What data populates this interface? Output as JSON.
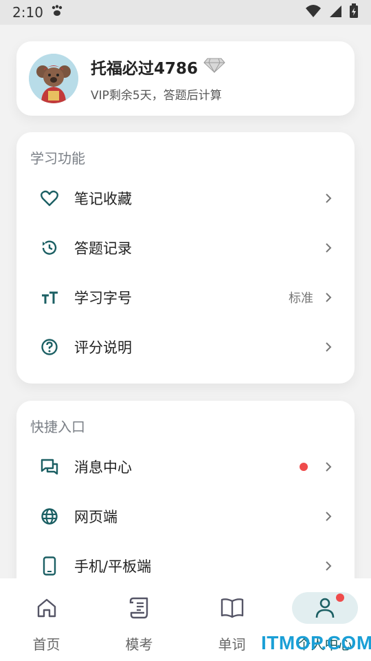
{
  "status_bar": {
    "time": "2:10"
  },
  "profile": {
    "name": "托福必过4786",
    "subtitle": "VIP剩余5天，答题后计算"
  },
  "learning": {
    "title": "学习功能",
    "items": [
      {
        "label": "笔记收藏",
        "icon": "heart-icon"
      },
      {
        "label": "答题记录",
        "icon": "history-icon"
      },
      {
        "label": "学习字号",
        "icon": "text-size-icon",
        "value": "标准"
      },
      {
        "label": "评分说明",
        "icon": "help-circle-icon"
      }
    ]
  },
  "quick": {
    "title": "快捷入口",
    "items": [
      {
        "label": "消息中心",
        "icon": "message-icon",
        "dot": true
      },
      {
        "label": "网页端",
        "icon": "globe-icon"
      },
      {
        "label": "手机/平板端",
        "icon": "phone-icon"
      }
    ]
  },
  "tabs": [
    {
      "label": "首页",
      "icon": "home-icon"
    },
    {
      "label": "模考",
      "icon": "scroll-icon"
    },
    {
      "label": "单词",
      "icon": "book-icon"
    },
    {
      "label": "个人中心",
      "icon": "person-icon",
      "active": true,
      "badge": true
    }
  ],
  "watermark": "ITMOP.COM",
  "colors": {
    "accent": "#1b5f63",
    "badge": "#ef4b4b",
    "background": "#f2f2f2"
  }
}
